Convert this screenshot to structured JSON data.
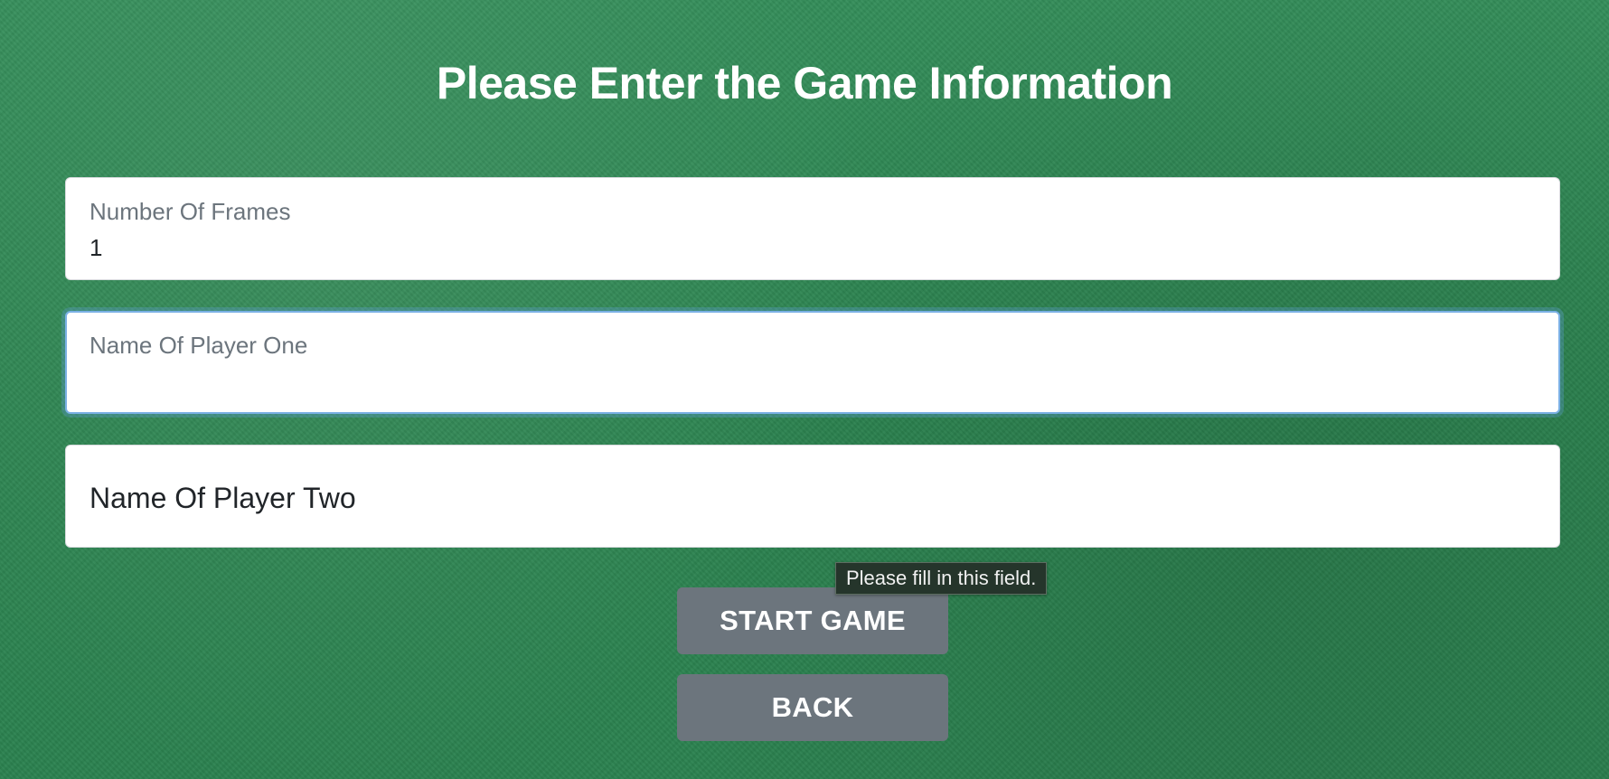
{
  "page": {
    "title": "Please Enter the Game Information"
  },
  "form": {
    "frames": {
      "label": "Number Of Frames",
      "value": "1"
    },
    "player_one": {
      "label": "Name Of Player One",
      "value": ""
    },
    "player_two": {
      "placeholder": "Name Of Player Two",
      "value": ""
    }
  },
  "validation": {
    "message": "Please fill in this field."
  },
  "buttons": {
    "start_label": "START GAME",
    "back_label": "BACK"
  },
  "colors": {
    "background": "#2f8a55",
    "button": "#6c757d",
    "focus_ring": "#7ab0e4",
    "title": "#ffffff"
  }
}
